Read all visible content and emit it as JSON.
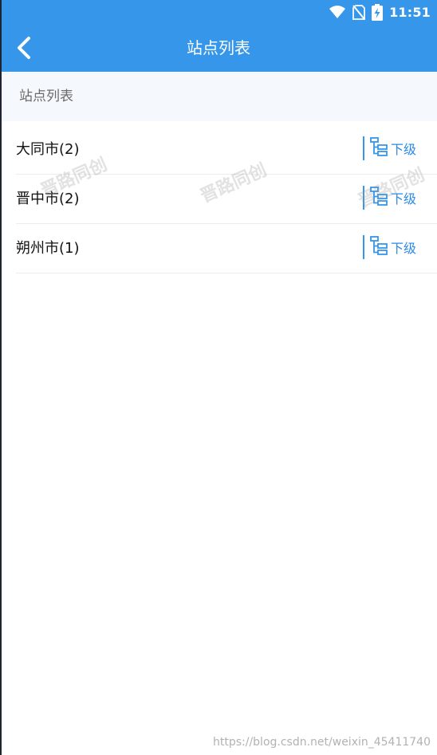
{
  "status_bar": {
    "time": "11:51",
    "icons": [
      "wifi-icon",
      "no-sim-icon",
      "battery-charging-icon"
    ]
  },
  "header": {
    "title": "站点列表",
    "back_icon": "chevron-left-icon"
  },
  "section": {
    "title": "站点列表"
  },
  "list": {
    "items": [
      {
        "label": "大同市(2)",
        "sub_label": "下级",
        "sub_icon": "hierarchy-icon"
      },
      {
        "label": "晋中市(2)",
        "sub_label": "下级",
        "sub_icon": "hierarchy-icon"
      },
      {
        "label": "朔州市(1)",
        "sub_label": "下级",
        "sub_icon": "hierarchy-icon"
      }
    ]
  },
  "watermark": {
    "text": "晋路同创",
    "url": "https://blog.csdn.net/weixin_45411740"
  },
  "colors": {
    "primary": "#3596ea",
    "section_bg": "#f5f8fc",
    "link": "#2d8ae6",
    "divider": "#ececec"
  }
}
